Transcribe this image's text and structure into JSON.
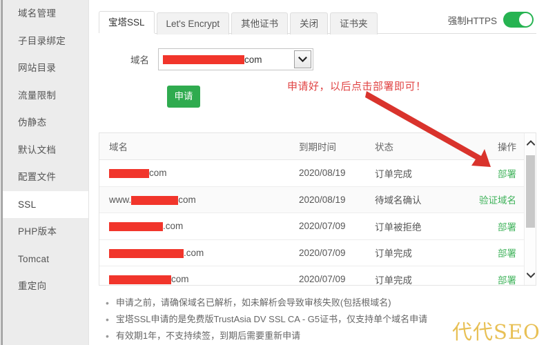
{
  "sidebar": {
    "items": [
      {
        "label": "域名管理",
        "active": false
      },
      {
        "label": "子目录绑定",
        "active": false
      },
      {
        "label": "网站目录",
        "active": false
      },
      {
        "label": "流量限制",
        "active": false
      },
      {
        "label": "伪静态",
        "active": false
      },
      {
        "label": "默认文档",
        "active": false
      },
      {
        "label": "配置文件",
        "active": false
      },
      {
        "label": "SSL",
        "active": true
      },
      {
        "label": "PHP版本",
        "active": false
      },
      {
        "label": "Tomcat",
        "active": false
      },
      {
        "label": "重定向",
        "active": false
      }
    ]
  },
  "tabs": [
    {
      "label": "宝塔SSL",
      "active": true
    },
    {
      "label": "Let's Encrypt",
      "active": false
    },
    {
      "label": "其他证书",
      "active": false
    },
    {
      "label": "关闭",
      "active": false
    },
    {
      "label": "证书夹",
      "active": false
    }
  ],
  "https": {
    "label": "强制HTTPS",
    "enabled": true,
    "on_color": "#26b351"
  },
  "form": {
    "domain_label": "域名",
    "domain_value_suffix": "com",
    "domain_redacted": true,
    "apply_label": "申请",
    "apply_color": "#2fab4f"
  },
  "annotation": {
    "text": "申请好，以后点击部署即可！",
    "color": "#e04444",
    "arrow_color": "#d9332c"
  },
  "table": {
    "headers": [
      "域名",
      "到期时间",
      "状态",
      "操作"
    ],
    "rows": [
      {
        "domain_prefix": "",
        "domain_redact_width": 58,
        "domain_suffix": "com",
        "expiry": "2020/08/19",
        "status": "订单完成",
        "action": "部署",
        "alt": false
      },
      {
        "domain_prefix": "www.",
        "domain_redact_width": 68,
        "domain_suffix": "com",
        "expiry": "2020/08/19",
        "status": "待域名确认",
        "action": "验证域名",
        "alt": true
      },
      {
        "domain_prefix": "",
        "domain_redact_width": 78,
        "domain_suffix": ".com",
        "expiry": "2020/07/09",
        "status": "订单被拒绝",
        "action": "部署",
        "alt": false
      },
      {
        "domain_prefix": "",
        "domain_redact_width": 108,
        "domain_suffix": ".com",
        "expiry": "2020/07/09",
        "status": "订单完成",
        "action": "部署",
        "alt": false
      },
      {
        "domain_prefix": "",
        "domain_redact_width": 90,
        "domain_suffix": "com",
        "expiry": "2020/07/09",
        "status": "订单完成",
        "action": "部署",
        "alt": false
      }
    ],
    "action_color": "#41b35c"
  },
  "notes": [
    "申请之前，请确保域名已解析，如未解析会导致审核失败(包括根域名)",
    "宝塔SSL申请的是免费版TrustAsia DV SSL CA - G5证书，仅支持单个域名申请",
    "有效期1年，不支持续签，到期后需要重新申请"
  ],
  "watermark": {
    "text": "代代SEO",
    "color": "#e8c055"
  }
}
